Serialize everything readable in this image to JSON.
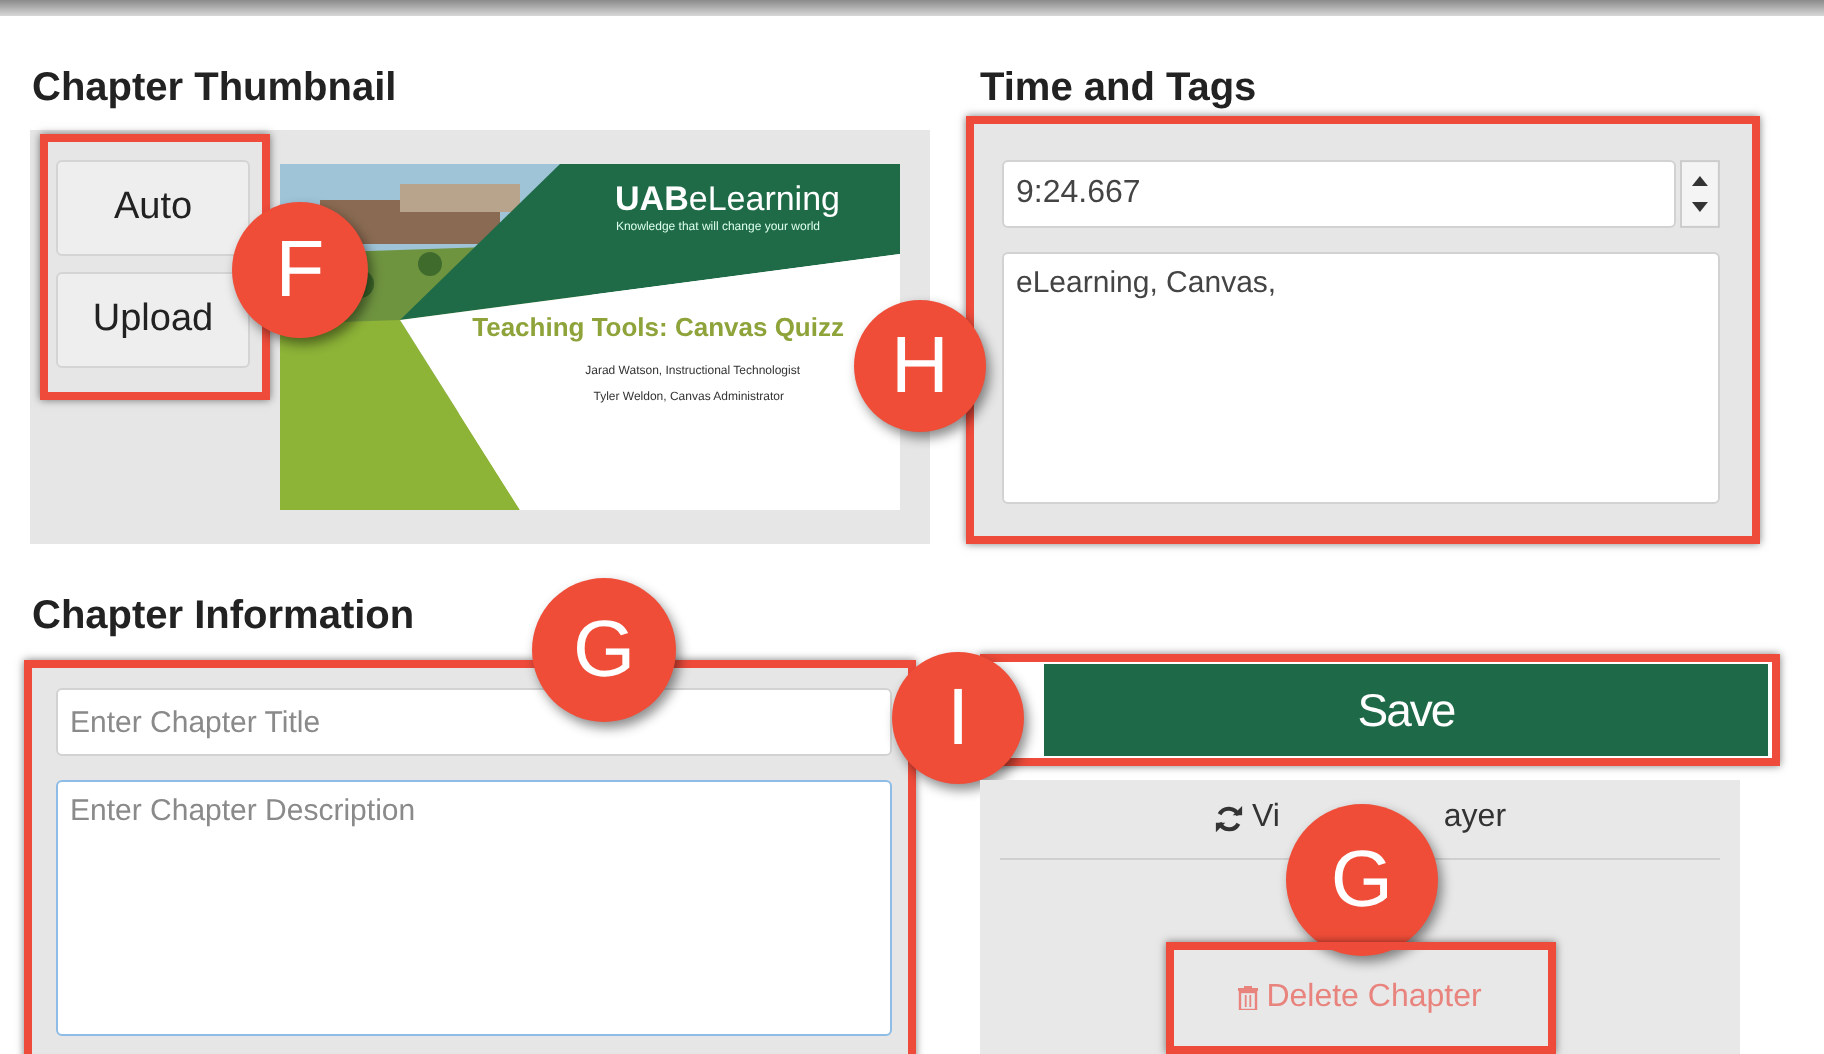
{
  "thumbnail": {
    "title": "Chapter Thumbnail",
    "marker": "F",
    "buttons": [
      "Auto",
      "Upload"
    ],
    "slide": {
      "brand": "UAB",
      "brand_suffix": "eLearning",
      "tagline": "Knowledge that will change your world",
      "heading": "Teaching Tools: Canvas Quizz",
      "authors": [
        "Jarad Watson, Instructional Technologist",
        "Tyler Weldon, Canvas Administrator"
      ]
    }
  },
  "time_tags": {
    "title": "Time and Tags",
    "marker": "H",
    "time": "9:24.667",
    "tags": "eLearning, Canvas,"
  },
  "chapter_info": {
    "title": "Chapter Information",
    "marker": "G",
    "title_placeholder": "Enter Chapter Title",
    "description_placeholder": "Enter Chapter Description"
  },
  "save": {
    "label": "Save",
    "marker": "I"
  },
  "actions": {
    "view_visible_start": "Vi",
    "view_visible_end": "ayer",
    "marker": "G",
    "delete": "Delete Chapter"
  }
}
